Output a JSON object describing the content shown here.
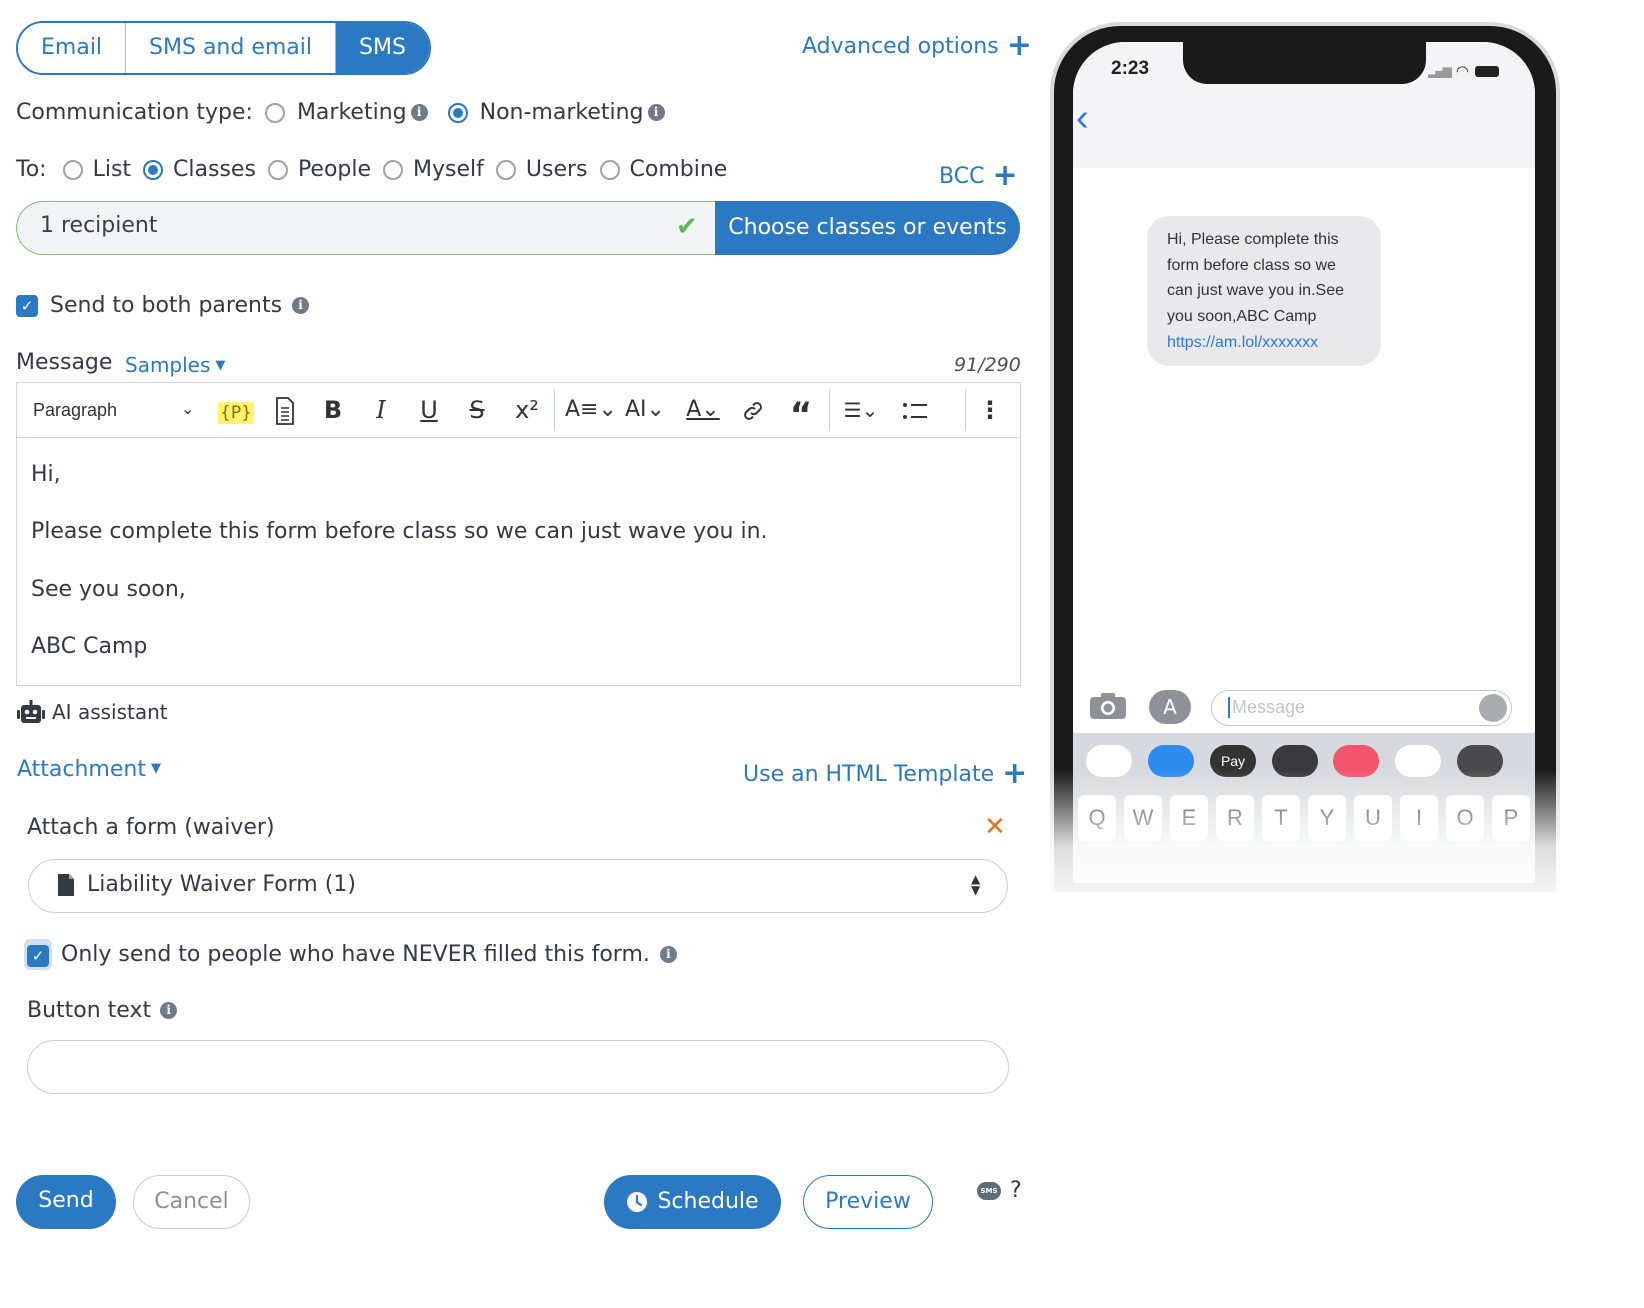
{
  "tabs": [
    "Email",
    "SMS and email",
    "SMS"
  ],
  "advanced_options": "Advanced options",
  "communication": {
    "label": "Communication type:",
    "marketing": "Marketing",
    "non_marketing": "Non-marketing"
  },
  "to": {
    "label": "To:",
    "options": [
      "List",
      "Classes",
      "People",
      "Myself",
      "Users",
      "Combine"
    ],
    "bcc": "BCC"
  },
  "recipient": {
    "value": "1 recipient",
    "button": "Choose classes or events"
  },
  "send_both_parents": "Send to both parents",
  "message": {
    "label": "Message",
    "samples": "Samples",
    "counter": "91/290",
    "paragraph_select": "Paragraph",
    "placeholder_token": "{P}",
    "lines": [
      "Hi,",
      "Please complete this form before class so we can just wave you in.",
      "See you soon,",
      "ABC Camp"
    ]
  },
  "ai_assistant": "AI assistant",
  "attachment": "Attachment",
  "html_template": "Use an HTML Template",
  "attach_form": {
    "label": "Attach a form (waiver)",
    "selected": "Liability Waiver Form (1)",
    "only_never": "Only send to people who have NEVER filled this form."
  },
  "button_text": {
    "label": "Button text",
    "value": ""
  },
  "footer": {
    "send": "Send",
    "cancel": "Cancel",
    "schedule": "Schedule",
    "preview": "Preview",
    "help": "?",
    "sms_badge": "SMS"
  },
  "phone": {
    "time": "2:23",
    "bubble_lines": [
      "Hi, Please complete this",
      "form before class so we",
      "can just wave you in.See",
      "you soon,ABC Camp"
    ],
    "bubble_link": "https://am.lol/xxxxxxx",
    "input_placeholder": "Message",
    "apple_pay": "Pay",
    "keys": [
      "Q",
      "W",
      "E",
      "R",
      "T",
      "Y",
      "U",
      "I",
      "O",
      "P"
    ]
  },
  "colors": {
    "accent": "#2b79c2",
    "success": "#5cb85c",
    "remove": "#e8741e"
  }
}
